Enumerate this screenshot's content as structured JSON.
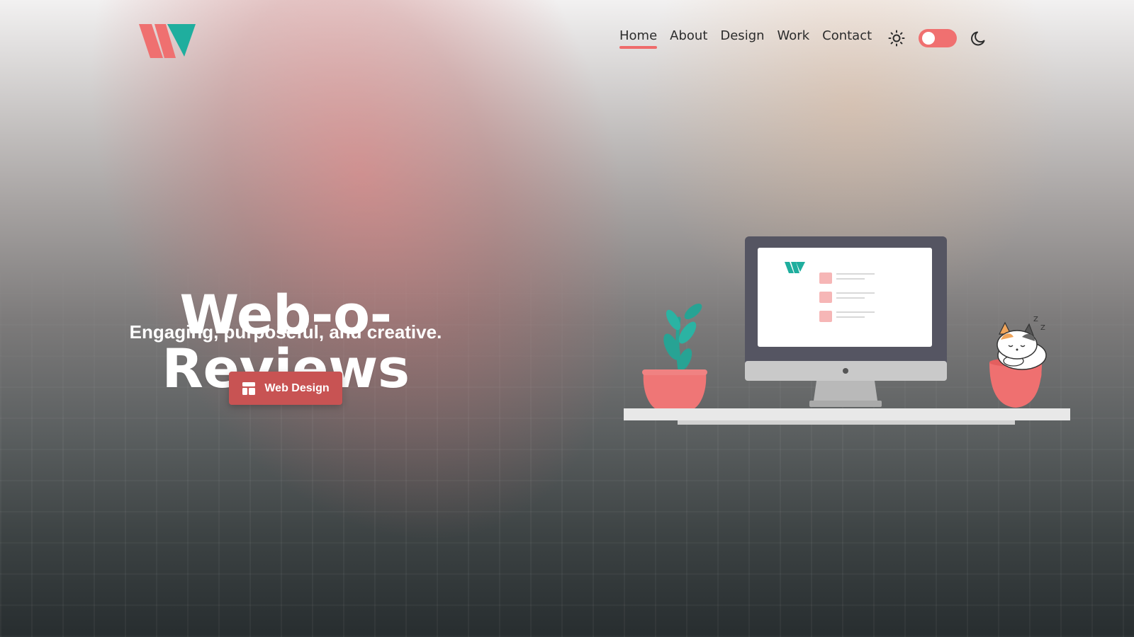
{
  "nav": {
    "items": [
      {
        "label": "Home",
        "active": true
      },
      {
        "label": "About",
        "active": false
      },
      {
        "label": "Design",
        "active": false
      },
      {
        "label": "Work",
        "active": false
      },
      {
        "label": "Contact",
        "active": false
      }
    ],
    "theme_toggle": {
      "light_icon": "sun-icon",
      "dark_icon": "moon-icon",
      "mode": "light"
    }
  },
  "hero": {
    "title": "Web-o-Reviews",
    "subtitle": "Engaging, purposeful, and creative.",
    "cta": {
      "label": "Web Design",
      "icon": "layout-icon"
    }
  },
  "colors": {
    "accent": "#ef6b6b",
    "button": "#c85353",
    "teal": "#20a99a"
  }
}
